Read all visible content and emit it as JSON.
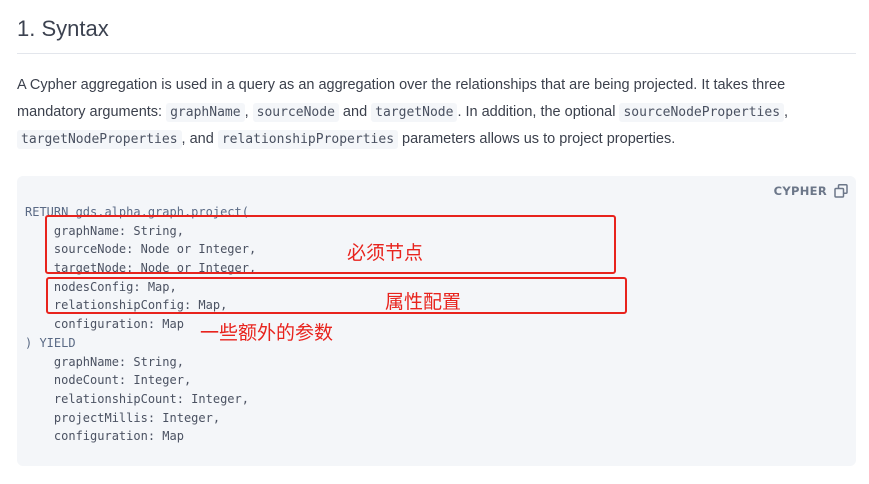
{
  "heading": "1. Syntax",
  "paragraph": {
    "t1": "A Cypher aggregation is used in a query as an aggregation over the relationships that are being projected. It takes three mandatory arguments: ",
    "c1": "graphName",
    "t2": ", ",
    "c2": "sourceNode",
    "t3": " and ",
    "c3": "targetNode",
    "t4": ". In addition, the optional ",
    "c4": "sourceNodeProperties",
    "t5": ", ",
    "c5": "targetNodeProperties",
    "t6": ", and ",
    "c6": "relationshipProperties",
    "t7": " parameters allows us to project properties."
  },
  "code_block": {
    "language": "CYPHER",
    "copy_icon": "copy-icon",
    "lines": [
      "RETURN gds.alpha.graph.project(",
      "    graphName: String,",
      "    sourceNode: Node or Integer,",
      "    targetNode: Node or Integer,",
      "    nodesConfig: Map,",
      "    relationshipConfig: Map,",
      "    configuration: Map",
      ") YIELD",
      "    graphName: String,",
      "    nodeCount: Integer,",
      "    relationshipCount: Integer,",
      "    projectMillis: Integer,",
      "    configuration: Map"
    ]
  },
  "annotations": {
    "required_nodes": "必须节点",
    "property_config": "属性配置",
    "extra_params": "一些额外的参数"
  },
  "colors": {
    "annotation": "#e8231d",
    "code_background": "#f4f6f9"
  }
}
